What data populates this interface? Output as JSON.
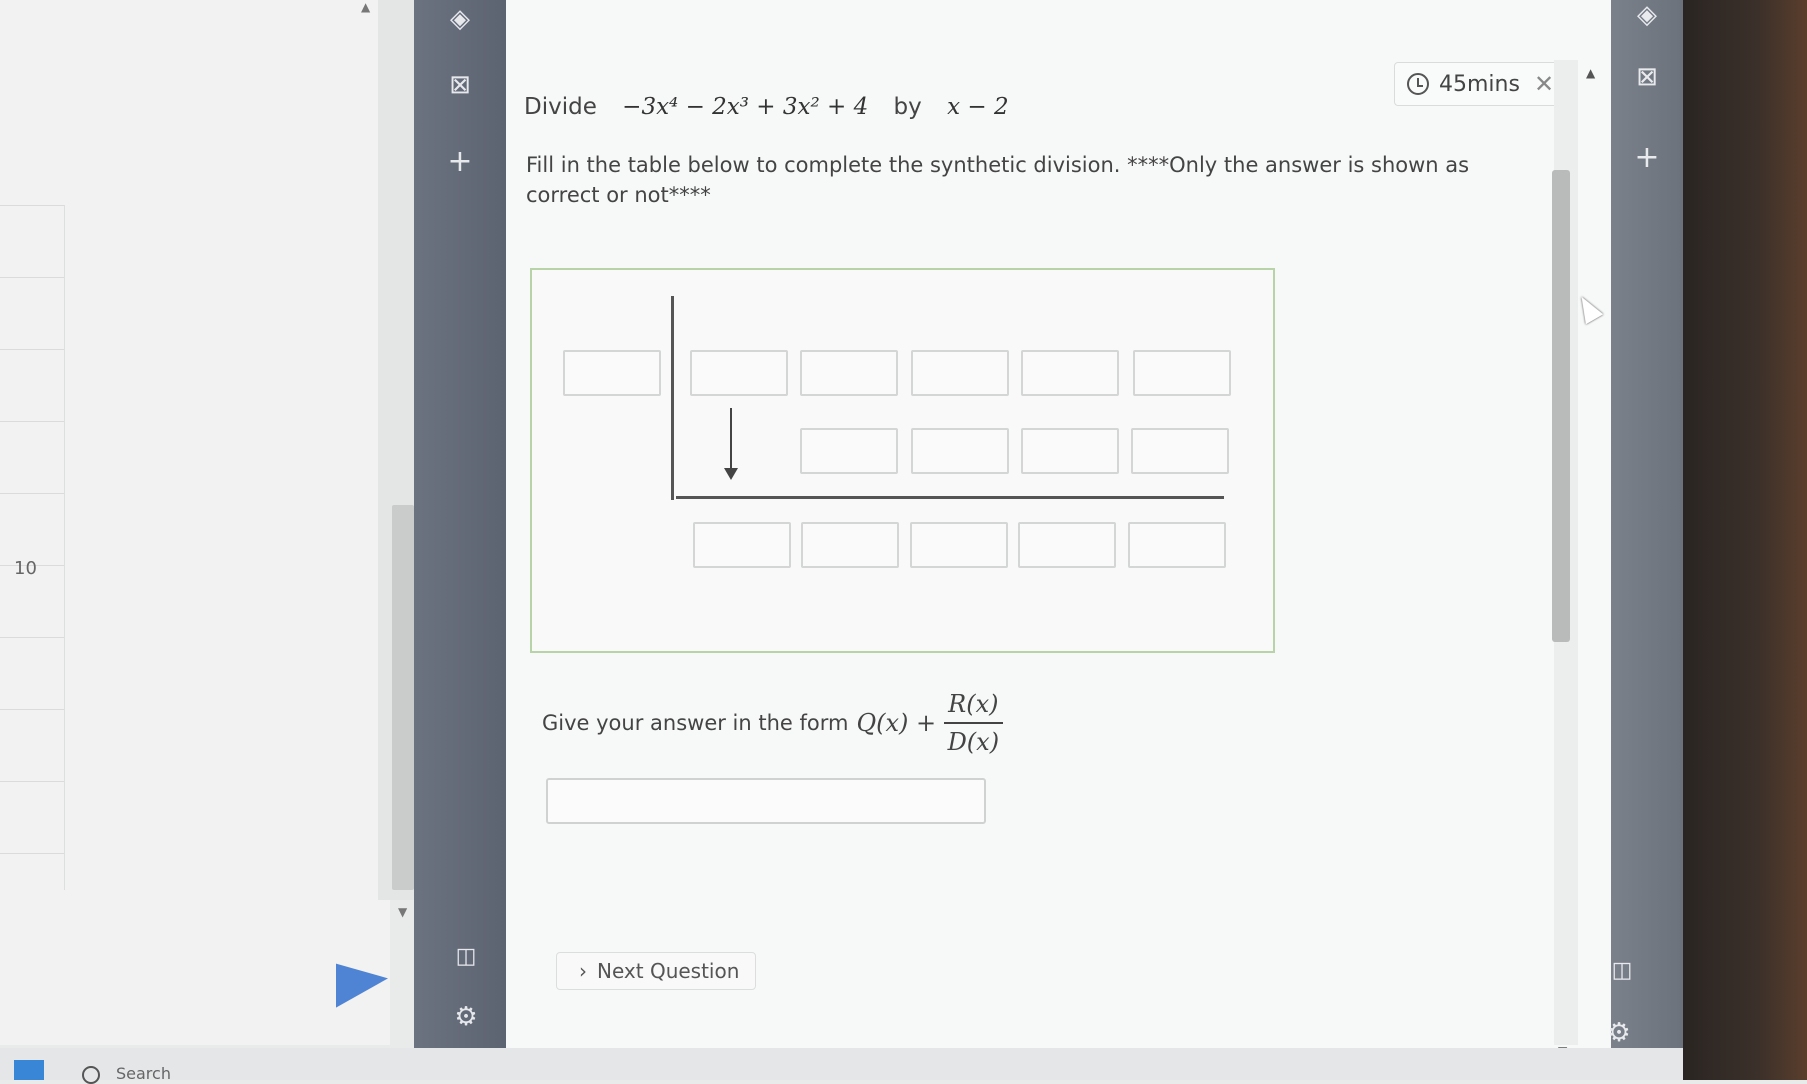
{
  "question": {
    "divide_word": "Divide",
    "dividend": "−3x⁴ − 2x³ + 3x² + 4",
    "by_word": "by",
    "divisor": "x − 2",
    "instruction": "Fill in the table below to complete the synthetic division.   ****Only the answer is shown as correct  or not****"
  },
  "timer": {
    "label": "45mins",
    "close": "✕"
  },
  "answer": {
    "prompt": "Give your answer in the form",
    "q_expr": "Q(x) +",
    "numerator": "R(x)",
    "denominator": "D(x)",
    "value": ""
  },
  "next_button": {
    "chevron": "›",
    "label": "Next Question"
  },
  "left_app": {
    "row_number": "10"
  },
  "taskbar": {
    "search_label": "Search"
  },
  "icons": {
    "sidebar": [
      "copilot-icon",
      "outlook-icon",
      "add-icon",
      "panel-icon",
      "settings-icon"
    ],
    "send": "send-arrow-icon"
  },
  "colors": {
    "table_border": "#b9d3a8",
    "sidebar_bg": "#6b7280",
    "send_arrow": "#4f84d4"
  }
}
